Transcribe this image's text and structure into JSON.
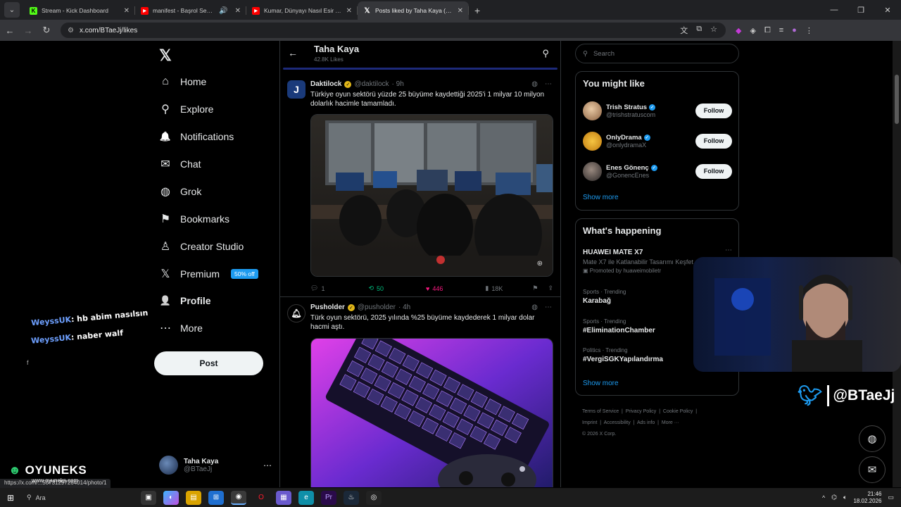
{
  "browser": {
    "tabs": [
      {
        "title": "Stream - Kick Dashboard",
        "color": "#53fc18",
        "glyph": "K"
      },
      {
        "title": "manifest - Başrol Sensin | O",
        "color": "#ff0000",
        "glyph": "▶"
      },
      {
        "title": "Kumar, Dünyayı Nasıl Esir Alıyo",
        "color": "#ff0000",
        "glyph": "▶"
      },
      {
        "title": "Posts liked by Taha Kaya (@BTa",
        "color": "#ffffff",
        "glyph": "𝕏"
      }
    ],
    "url": "x.com/BTaeJj/likes"
  },
  "nav": {
    "items": [
      {
        "label": "Home",
        "icon": "⌂"
      },
      {
        "label": "Explore",
        "icon": "⚲"
      },
      {
        "label": "Notifications",
        "icon": "🔔"
      },
      {
        "label": "Chat",
        "icon": "✉"
      },
      {
        "label": "Grok",
        "icon": "◍"
      },
      {
        "label": "Bookmarks",
        "icon": "⚑"
      },
      {
        "label": "Creator Studio",
        "icon": "♙"
      },
      {
        "label": "Premium",
        "icon": "𝕏"
      },
      {
        "label": "Profile",
        "icon": "👤"
      },
      {
        "label": "More",
        "icon": "⋯"
      }
    ],
    "premium_badge": "50% off",
    "post_label": "Post",
    "account": {
      "name": "Taha Kaya",
      "handle": "@BTaeJj"
    }
  },
  "header": {
    "name": "Taha Kaya",
    "likes": "42.8K Likes"
  },
  "tweets": [
    {
      "name": "Daktilock",
      "handle": "@daktilock",
      "time": "· 9h",
      "text": "Türkiye oyun sektörü yüzde 25 büyüme kaydettiği 2025'i 1 milyar 10 milyon dolarlık hacimle tamamladı.",
      "replies": "1",
      "reposts": "50",
      "likes": "446",
      "views": "18K"
    },
    {
      "name": "Pusholder",
      "handle": "@pusholder",
      "time": "· 4h",
      "text": "Türk oyun sektörü, 2025 yılında %25 büyüme kaydederek 1 milyar dolar hacmi aştı."
    }
  ],
  "right": {
    "search_placeholder": "Search",
    "you_might_like_title": "You might like",
    "suggestions": [
      {
        "name": "Trish Stratus",
        "handle": "@trishstratuscom"
      },
      {
        "name": "OnlyDrama",
        "handle": "@onlydramaX"
      },
      {
        "name": "Enes Gönenç",
        "handle": "@GonencEnes"
      }
    ],
    "follow_label": "Follow",
    "show_more": "Show more",
    "happening_title": "What's happening",
    "trends": [
      {
        "meta": "",
        "title": "HUAWEI MATE X7",
        "sub": "Mate X7 ile Katlanabilir Tasarımı Keşfet",
        "promo": "Promoted by huaweimobiletr"
      },
      {
        "meta": "Sports · Trending",
        "title": "Karabağ"
      },
      {
        "meta": "Sports · Trending",
        "title": "#EliminationChamber"
      },
      {
        "meta": "Politics · Trending",
        "title": "#VergiSGKYapılandırma"
      }
    ],
    "footer": [
      "Terms of Service",
      "Privacy Policy",
      "Cookie Policy",
      "Imprint",
      "Accessibility",
      "Ads info",
      "More ···",
      "© 2026 X Corp."
    ]
  },
  "overlay": {
    "chat": [
      {
        "user": "WeyssUK",
        "msg": ": hb abim nasılsın"
      },
      {
        "user": "WeyssUK",
        "msg": ": naber walf"
      }
    ],
    "brand_handle": "@BTaeJj",
    "logo_name": "OYUNEKS",
    "logo_url": "www.oyuneks.com",
    "status_url": "https://x.com/...50731297264014/photo/1"
  },
  "taskbar": {
    "search": "Ara",
    "time": "21:46",
    "date": "18.02.2026"
  }
}
